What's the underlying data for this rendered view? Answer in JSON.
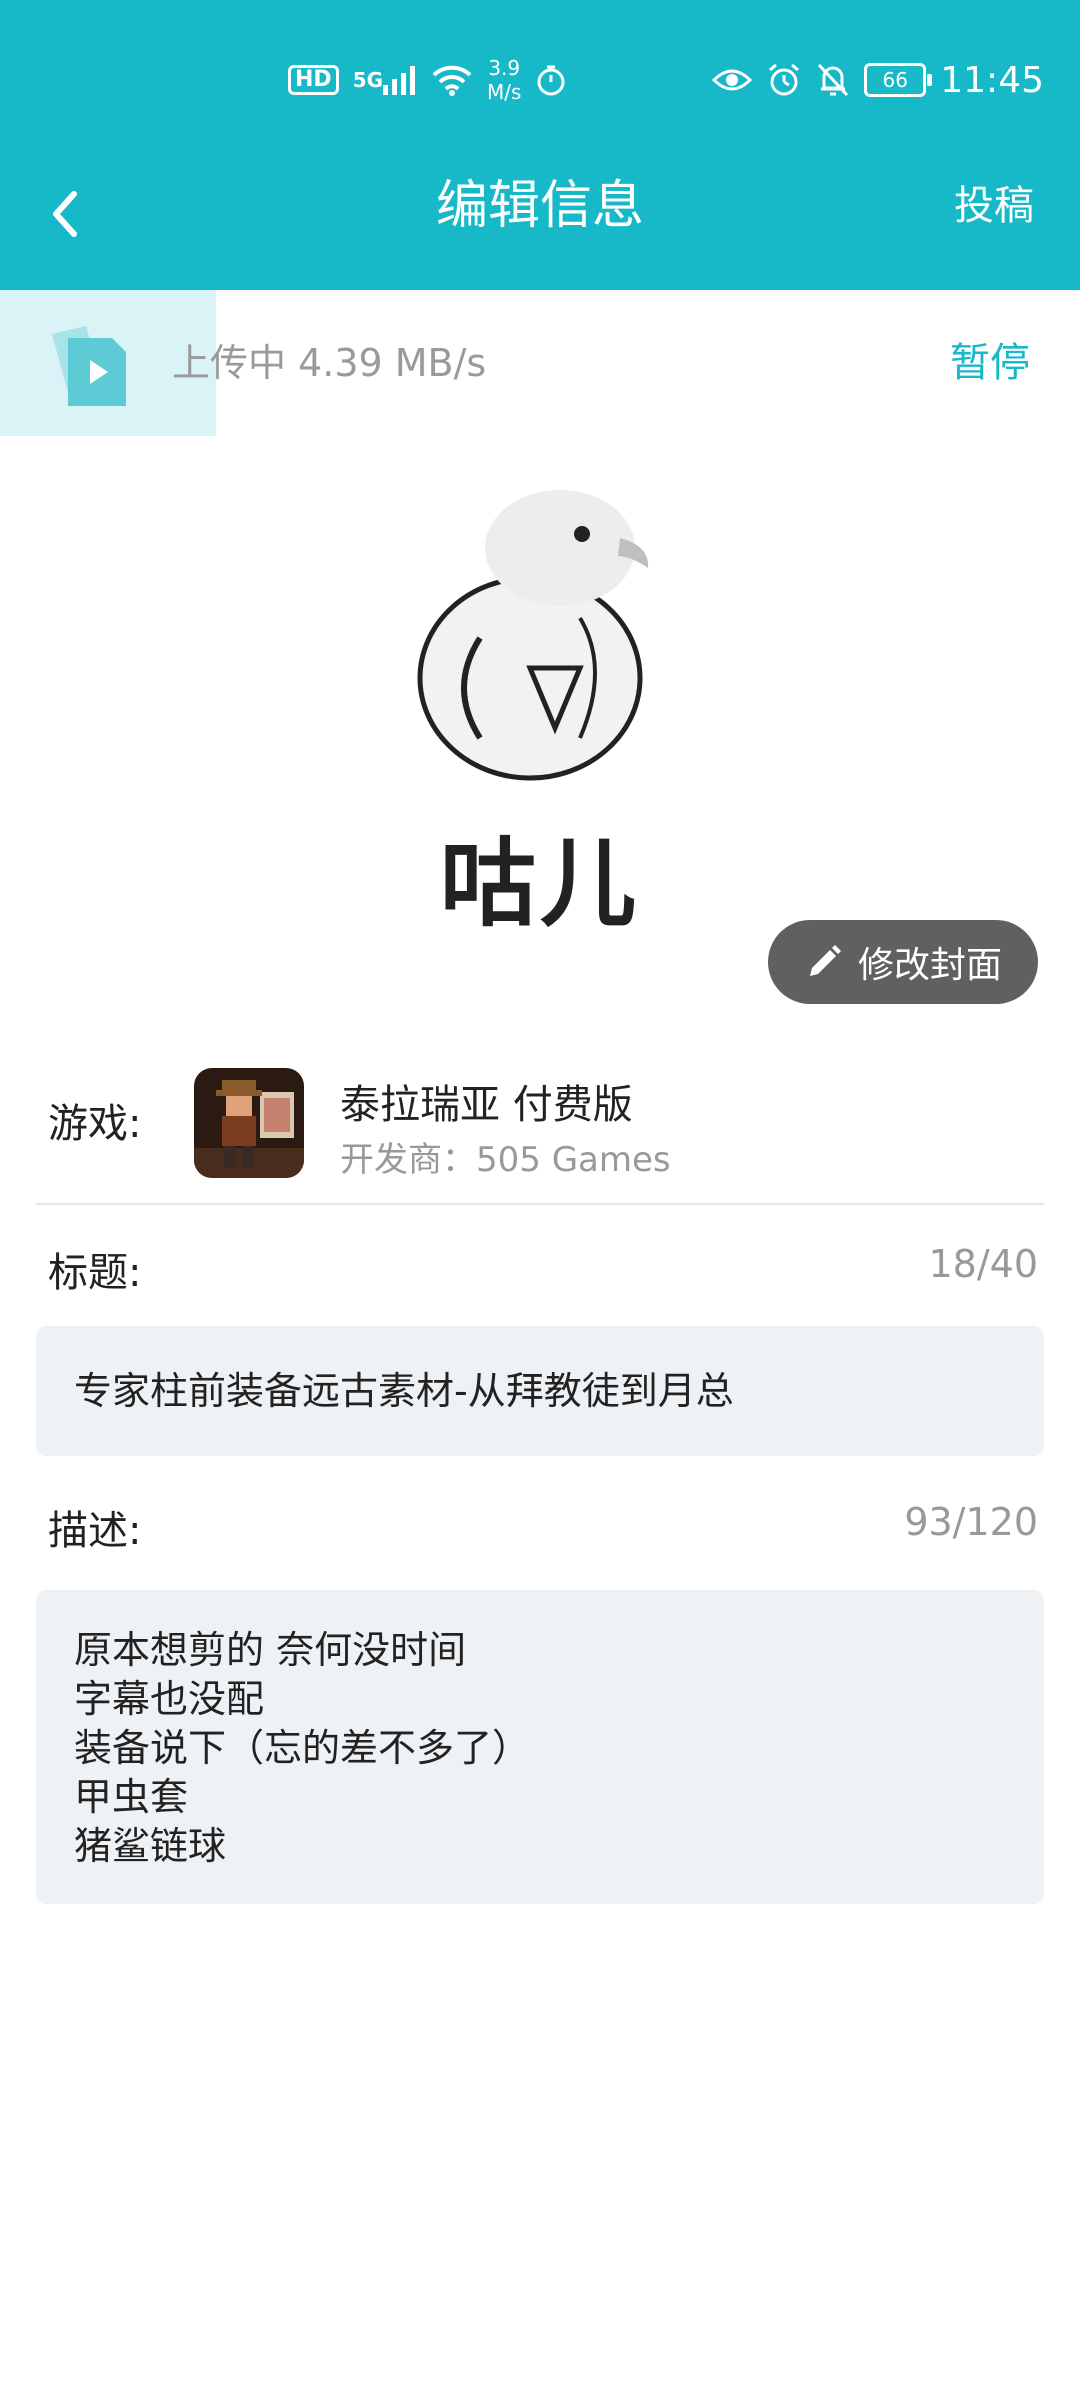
{
  "status_bar": {
    "hd": "HD",
    "network": "5G",
    "speed_value": "3.9",
    "speed_unit": "M/s",
    "battery": "66",
    "time": "11:45"
  },
  "app_bar": {
    "title": "编辑信息",
    "submit_label": "投稿"
  },
  "upload": {
    "status_text": "上传中 4.39 MB/s",
    "pause_label": "暂停",
    "progress_fraction": 0.2
  },
  "cover": {
    "caption": "咕儿",
    "edit_label": "修改封面"
  },
  "game": {
    "label": "游戏:",
    "name": "泰拉瑞亚 付费版",
    "developer": "开发商：505 Games"
  },
  "title_field": {
    "label": "标题:",
    "counter": "18/40",
    "value": "专家柱前装备远古素材-从拜教徒到月总"
  },
  "description_field": {
    "label": "描述:",
    "counter": "93/120",
    "lines": [
      "原本想剪的  奈何没时间",
      "字幕也没配",
      "装备说下（忘的差不多了）",
      "甲虫套",
      "猪鲨链球"
    ]
  },
  "colors": {
    "accent": "#17b8c8",
    "upload_fill": "#d9f3f6",
    "field_bg": "#eef2f5",
    "edit_button_bg": "#606060"
  }
}
